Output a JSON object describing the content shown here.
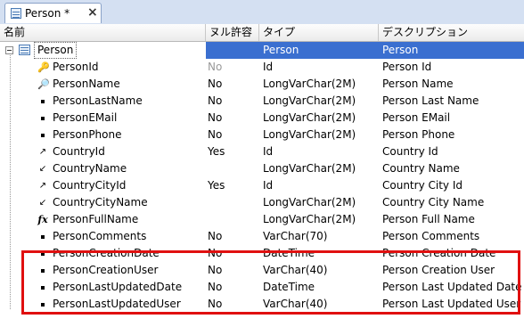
{
  "tab": {
    "label": "Person *",
    "close": "×"
  },
  "columns": [
    "名前",
    "ヌル許容",
    "タイプ",
    "デスクリプション"
  ],
  "root": {
    "name": "Person",
    "type": "Person",
    "description": "Person"
  },
  "rows": [
    {
      "name": "PersonId",
      "icon": "key-icon",
      "nullable": "No",
      "nullable_gray": true,
      "type": "Id",
      "description": "Person Id"
    },
    {
      "name": "PersonName",
      "icon": "magnifier-icon",
      "nullable": "No",
      "type": "LongVarChar(2M)",
      "description": "Person Name"
    },
    {
      "name": "PersonLastName",
      "icon": "bullet-icon",
      "nullable": "No",
      "type": "LongVarChar(2M)",
      "description": "Person Last Name"
    },
    {
      "name": "PersonEMail",
      "icon": "bullet-icon",
      "nullable": "No",
      "type": "LongVarChar(2M)",
      "description": "Person EMail"
    },
    {
      "name": "PersonPhone",
      "icon": "bullet-icon",
      "nullable": "No",
      "type": "LongVarChar(2M)",
      "description": "Person Phone"
    },
    {
      "name": "CountryId",
      "icon": "foreign-key-icon",
      "nullable": "Yes",
      "type": "Id",
      "description": "Country Id"
    },
    {
      "name": "CountryName",
      "icon": "inferred-icon",
      "nullable": "",
      "type": "LongVarChar(2M)",
      "description": "Country Name"
    },
    {
      "name": "CountryCityId",
      "icon": "foreign-key-icon",
      "nullable": "Yes",
      "type": "Id",
      "description": "Country City Id"
    },
    {
      "name": "CountryCityName",
      "icon": "inferred-icon",
      "nullable": "",
      "type": "LongVarChar(2M)",
      "description": "Country City Name"
    },
    {
      "name": "PersonFullName",
      "icon": "formula-icon",
      "nullable": "",
      "type": "LongVarChar(2M)",
      "description": "Person Full Name"
    },
    {
      "name": "PersonComments",
      "icon": "bullet-icon",
      "nullable": "No",
      "type": "VarChar(70)",
      "description": "Person Comments"
    },
    {
      "name": "PersonCreationDate",
      "icon": "bullet-icon",
      "nullable": "No",
      "type": "DateTime",
      "description": "Person Creation Date"
    },
    {
      "name": "PersonCreationUser",
      "icon": "bullet-icon",
      "nullable": "No",
      "type": "VarChar(40)",
      "description": "Person Creation User"
    },
    {
      "name": "PersonLastUpdatedDate",
      "icon": "bullet-icon",
      "nullable": "No",
      "type": "DateTime",
      "description": "Person Last Updated Date"
    },
    {
      "name": "PersonLastUpdatedUser",
      "icon": "bullet-icon",
      "nullable": "No",
      "type": "VarChar(40)",
      "description": "Person Last Updated User"
    }
  ],
  "colors": {
    "selection": "#3a6fd0",
    "highlight_box": "#e01010"
  }
}
